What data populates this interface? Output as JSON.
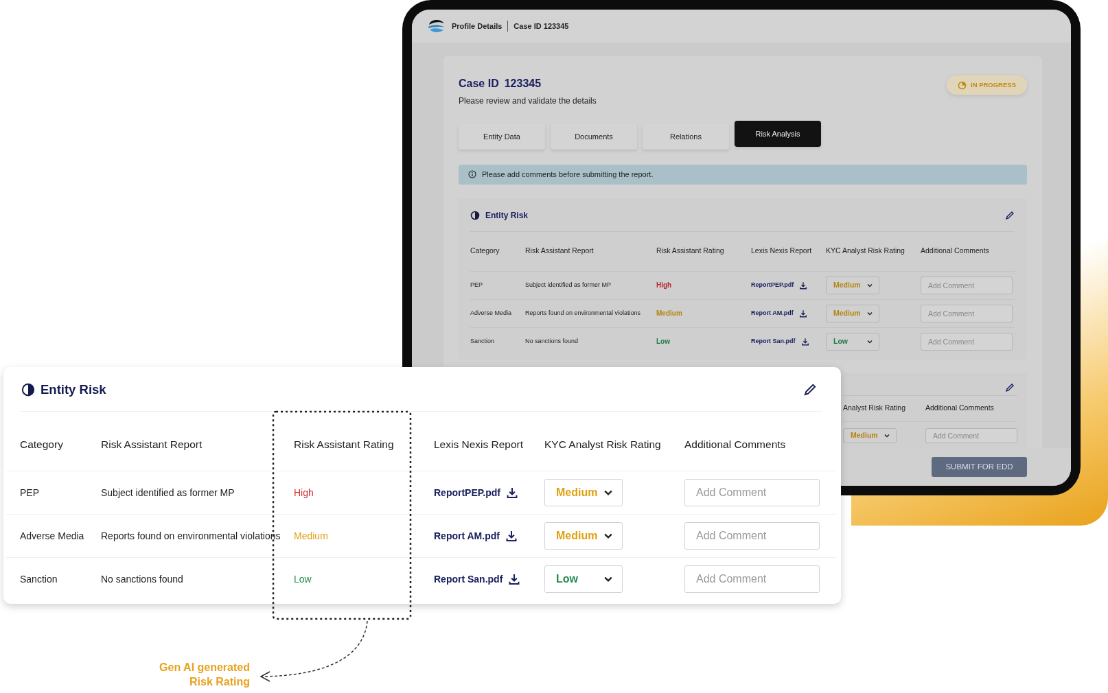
{
  "device": {
    "header": {
      "title": "Profile Details",
      "case": "Case ID 123345"
    },
    "case_card": {
      "title_label": "Case ID",
      "title_value": "123345",
      "subtitle": "Please review and validate the details",
      "status": "IN PROGRESS",
      "tabs": [
        {
          "label": "Entity Data",
          "selected": false
        },
        {
          "label": "Documents",
          "selected": false
        },
        {
          "label": "Relations",
          "selected": false
        },
        {
          "label": "Risk Analysis",
          "selected": true
        }
      ],
      "alert": "Please add comments before submitting the report.",
      "entity_risk": {
        "title": "Entity Risk",
        "columns": [
          "Category",
          "Risk Assistant Report",
          "Risk Assistant Rating",
          "Lexis Nexis Report",
          "KYC Analyst Risk Rating",
          "Additional Comments"
        ],
        "rows": [
          {
            "category": "PEP",
            "report": "Subject identified as former MP",
            "rating": {
              "text": "High",
              "color": "#b8262a"
            },
            "file": "ReportPEP.pdf",
            "kyc": {
              "value": "Medium",
              "color": "#b48410"
            },
            "comment_placeholder": "Add Comment"
          },
          {
            "category": "Adverse Media",
            "report": "Reports found on environmental violations",
            "rating": {
              "text": "Medium",
              "color": "#b48410"
            },
            "file": "Report AM.pdf",
            "kyc": {
              "value": "Medium",
              "color": "#b48410"
            },
            "comment_placeholder": "Add Comment"
          },
          {
            "category": "Sanction",
            "report": "No sanctions found",
            "rating": {
              "text": "Low",
              "color": "#1e7a45"
            },
            "file": "Report San.pdf",
            "kyc": {
              "value": "Low",
              "color": "#1e7a45"
            },
            "comment_placeholder": "Add Comment"
          }
        ]
      },
      "second_section": {
        "columns": [
          "Analyst Risk Rating",
          "Additional Comments"
        ],
        "kyc": {
          "value": "Medium",
          "color": "#b48410"
        },
        "comment_placeholder": "Add Comment"
      }
    },
    "footer": {
      "button": "SUBMIT FOR EDD"
    }
  },
  "zoom_card": {
    "title": "Entity Risk",
    "columns": [
      "Category",
      "Risk Assistant Report",
      "Risk Assistant Rating",
      "Lexis Nexis Report",
      "KYC Analyst Risk Rating",
      "Additional Comments"
    ],
    "rows": [
      {
        "category": "PEP",
        "report": "Subject identified as former MP",
        "rating": {
          "text": "High",
          "color": "#d32f2f"
        },
        "file": "ReportPEP.pdf",
        "kyc": {
          "value": "Medium",
          "color": "#e0a010"
        },
        "comment_placeholder": "Add Comment"
      },
      {
        "category": "Adverse Media",
        "report": "Reports found on environmental violations",
        "rating": {
          "text": "Medium",
          "color": "#e0a010"
        },
        "file": "Report AM.pdf",
        "kyc": {
          "value": "Medium",
          "color": "#e0a010"
        },
        "comment_placeholder": "Add Comment"
      },
      {
        "category": "Sanction",
        "report": "No sanctions found",
        "rating": {
          "text": "Low",
          "color": "#1e8a4c"
        },
        "file": "Report San.pdf",
        "kyc": {
          "value": "Low",
          "color": "#1e8a4c"
        },
        "comment_placeholder": "Add Comment"
      }
    ]
  },
  "callout": {
    "lines": [
      "Gen AI generated",
      "Risk Rating"
    ]
  }
}
